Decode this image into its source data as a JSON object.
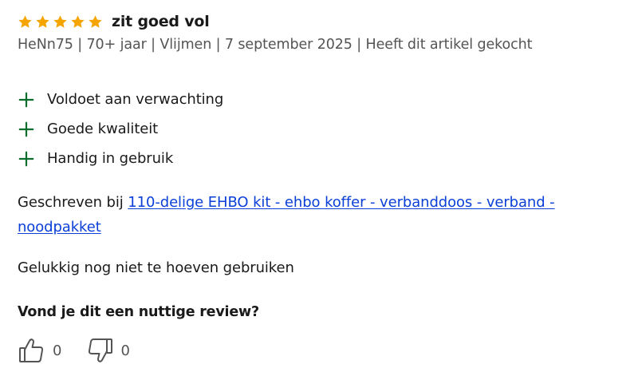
{
  "review": {
    "rating": 5,
    "max_rating": 5,
    "star_color": "#f5a400",
    "title": "zit goed vol",
    "meta": "HeNn75 | 70+ jaar | Vlijmen | 7 september 2025 | Heeft dit artikel gekocht",
    "pros": [
      {
        "icon": "plus-icon",
        "text": "Voldoet aan verwachting"
      },
      {
        "icon": "plus-icon",
        "text": "Goede kwaliteit"
      },
      {
        "icon": "plus-icon",
        "text": "Handig in gebruik"
      }
    ],
    "pro_icon_color": "#0b6e2d",
    "written_prefix": "Geschreven bij ",
    "product_link": "110-delige EHBO kit - ehbo koffer - verbanddoos - verband - noodpakket",
    "link_color": "#0a3fd8",
    "body": "Gelukkig nog niet te hoeven gebruiken",
    "helpful_question": "Vond je dit een nuttige review?",
    "votes": {
      "up": {
        "icon": "thumbs-up-icon",
        "count": "0"
      },
      "down": {
        "icon": "thumbs-down-icon",
        "count": "0"
      }
    }
  }
}
